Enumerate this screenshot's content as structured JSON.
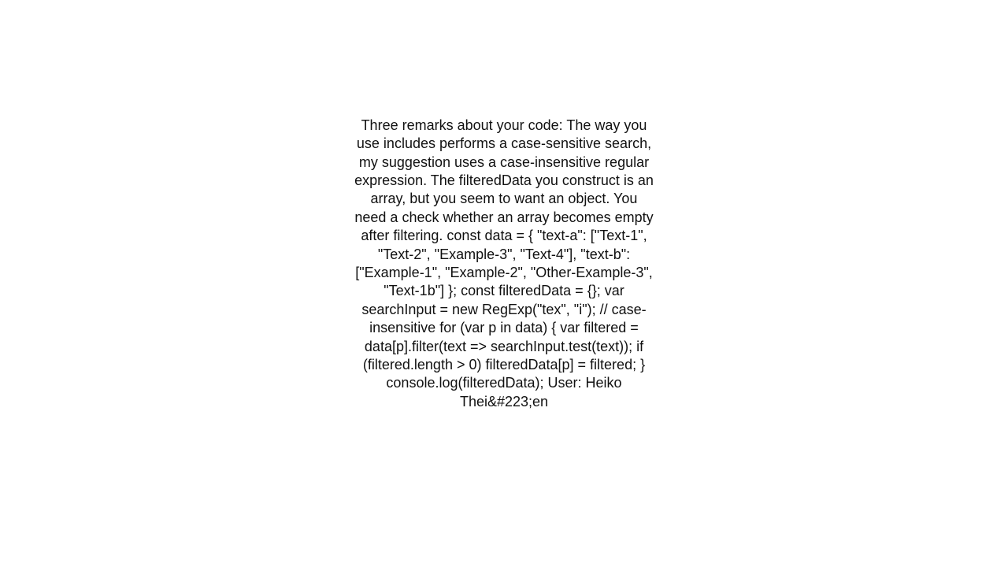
{
  "content": {
    "body_text": "Three remarks about your code:  The way you use includes performs a case-sensitive search, my suggestion uses a case-insensitive regular expression. The filteredData you construct is an array, but you seem to want an object. You need a check whether an array becomes empty after filtering.    const data = {   \"text-a\": [\"Text-1\", \"Text-2\", \"Example-3\", \"Text-4\"],   \"text-b\": [\"Example-1\", \"Example-2\", \"Other-Example-3\", \"Text-1b\"] }; const filteredData = {}; var searchInput = new RegExp(\"tex\", \"i\"); // case-insensitive for (var p in data) {   var filtered = data[p].filter(text => searchInput.test(text));   if (filtered.length > 0) filteredData[p] = filtered; } console.log(filteredData);    User: Heiko Thei&#223;en"
  }
}
